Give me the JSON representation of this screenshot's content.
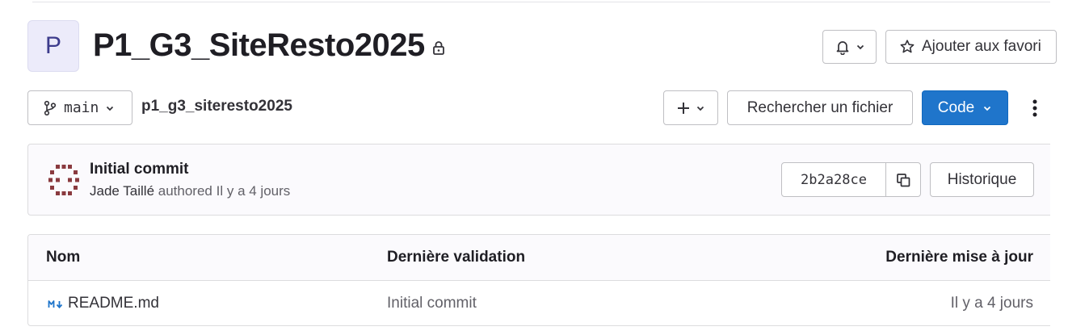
{
  "project": {
    "avatar_letter": "P",
    "name": "P1_G3_SiteResto2025",
    "visibility_icon": "lock-icon"
  },
  "header_actions": {
    "notifications_icon": "bell-icon",
    "favorite_label": "Ajouter aux favori"
  },
  "toolbar": {
    "branch": "main",
    "path": "p1_g3_siteresto2025",
    "add_icon": "plus-icon",
    "find_file_label": "Rechercher un fichier",
    "code_label": "Code",
    "more_icon": "kebab-icon"
  },
  "last_commit": {
    "title": "Initial commit",
    "author": "Jade Taillé",
    "authored_label": "authored",
    "time_ago": "Il y a 4 jours",
    "sha": "2b2a28ce",
    "copy_icon": "copy-icon",
    "history_label": "Historique"
  },
  "file_table": {
    "columns": [
      "Nom",
      "Dernière validation",
      "Dernière mise à jour"
    ],
    "rows": [
      {
        "name": "README.md",
        "icon": "markdown-icon",
        "last_commit": "Initial commit",
        "last_update": "Il y a 4 jours"
      }
    ]
  },
  "colors": {
    "primary": "#1f75cb",
    "avatar_bg": "#ecebfa",
    "identicon": "#8a3a3f"
  }
}
